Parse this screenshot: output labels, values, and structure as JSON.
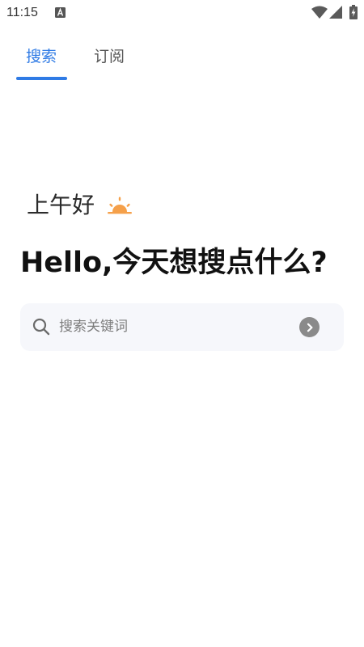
{
  "status_bar": {
    "time": "11:15",
    "icons": [
      "app-a-icon",
      "wifi-icon",
      "signal-icon",
      "battery-charging-icon"
    ]
  },
  "tabs": [
    {
      "label": "搜索",
      "active": true
    },
    {
      "label": "订阅",
      "active": false
    }
  ],
  "greeting": {
    "text": "上午好",
    "icon": "sunrise-icon"
  },
  "headline": "Hello,今天想搜点什么?",
  "search": {
    "placeholder": "搜索关键词",
    "value": "",
    "submit_icon": "chevron-right-icon"
  },
  "colors": {
    "accent": "#2f7be5",
    "sun": "#f5a04a",
    "search_bg": "#f6f7fb"
  }
}
